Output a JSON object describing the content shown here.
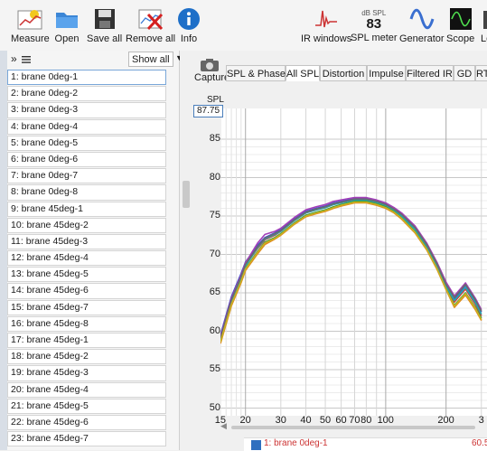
{
  "toolbar": {
    "measure": "Measure",
    "open": "Open",
    "save_all": "Save all",
    "remove_all": "Remove all",
    "info": "Info",
    "ir_windows": "IR windows",
    "spl_meter_unit": "dB SPL",
    "spl_meter_value": "83",
    "spl_meter": "SPL meter",
    "generator": "Generator",
    "scope": "Scope",
    "level_partial": "Le"
  },
  "list": {
    "nav_glyph": "»",
    "filter_value": "Show all",
    "items": [
      "1: brane 0deg-1",
      "2: brane 0deg-2",
      "3: brane 0deg-3",
      "4: brane 0deg-4",
      "5: brane 0deg-5",
      "6: brane 0deg-6",
      "7: brane 0deg-7",
      "8: brane 0deg-8",
      "9: brane 45deg-1",
      "10: brane 45deg-2",
      "11: brane 45deg-3",
      "12: brane 45deg-4",
      "13: brane 45deg-5",
      "14: brane 45deg-6",
      "15: brane 45deg-7",
      "16: brane 45deg-8",
      "17: brane 45deg-1",
      "18: brane 45deg-2",
      "19: brane 45deg-3",
      "20: brane 45deg-4",
      "21: brane 45deg-5",
      "22: brane 45deg-6",
      "23: brane 45deg-7"
    ]
  },
  "graph": {
    "capture": "Capture",
    "tabs": [
      "SPL & Phase",
      "All SPL",
      "Distortion",
      "Impulse",
      "Filtered IR",
      "GD",
      "RT"
    ],
    "active_tab": "All SPL",
    "y_unit": "SPL",
    "y_cursor": "87.75",
    "legend_first": "1: brane 0deg-1",
    "legend_value": "60.5"
  },
  "chart_data": {
    "type": "line",
    "title": "",
    "xlabel": "",
    "ylabel": "SPL",
    "x_scale": "log",
    "xlim": [
      15,
      320
    ],
    "ylim": [
      49,
      89
    ],
    "grid": true,
    "x_ticks": [
      "15",
      "20",
      "30",
      "40",
      "50",
      "60",
      "70",
      "80",
      "100",
      "200",
      "3"
    ],
    "y_ticks": [
      "85",
      "80",
      "75",
      "70",
      "65",
      "60",
      "55",
      "50"
    ],
    "x": [
      15,
      17,
      19,
      20,
      23,
      25,
      28,
      30,
      35,
      40,
      45,
      50,
      55,
      60,
      70,
      80,
      90,
      100,
      110,
      120,
      140,
      160,
      180,
      200,
      220,
      250,
      280,
      300
    ],
    "series": [
      {
        "color": "#3a4fd0",
        "values": [
          59.5,
          64.5,
          67.5,
          69.0,
          71.2,
          72.2,
          72.8,
          73.2,
          74.6,
          75.6,
          76.0,
          76.3,
          76.7,
          76.9,
          77.3,
          77.3,
          77.0,
          76.6,
          76.0,
          75.3,
          73.6,
          71.4,
          68.9,
          66.2,
          64.2,
          66.0,
          64.0,
          62.5
        ]
      },
      {
        "color": "#d23a3a",
        "values": [
          59.0,
          64.0,
          67.0,
          68.6,
          70.8,
          71.9,
          72.5,
          73.0,
          74.4,
          75.4,
          75.8,
          76.1,
          76.5,
          76.8,
          77.1,
          77.1,
          76.8,
          76.4,
          75.8,
          75.1,
          73.3,
          71.1,
          68.6,
          65.9,
          63.8,
          65.5,
          63.5,
          62.0
        ]
      },
      {
        "color": "#2e9a3a",
        "values": [
          58.7,
          63.6,
          66.6,
          68.2,
          70.4,
          71.6,
          72.2,
          72.7,
          74.1,
          75.1,
          75.5,
          75.8,
          76.2,
          76.5,
          76.9,
          76.9,
          76.6,
          76.2,
          75.6,
          74.8,
          73.0,
          70.8,
          68.3,
          65.6,
          63.4,
          65.0,
          63.1,
          61.7
        ]
      },
      {
        "color": "#a23fb8",
        "values": [
          59.3,
          64.3,
          67.3,
          68.9,
          71.5,
          72.6,
          73.0,
          73.4,
          74.8,
          75.8,
          76.2,
          76.5,
          76.9,
          77.1,
          77.4,
          77.4,
          77.1,
          76.7,
          76.1,
          75.4,
          73.7,
          71.5,
          69.0,
          66.4,
          64.6,
          66.3,
          64.3,
          62.8
        ]
      },
      {
        "color": "#e08a1e",
        "values": [
          58.4,
          63.3,
          66.3,
          67.9,
          70.1,
          71.3,
          72.0,
          72.5,
          73.9,
          74.9,
          75.3,
          75.6,
          76.0,
          76.3,
          76.7,
          76.7,
          76.4,
          76.0,
          75.4,
          74.6,
          72.8,
          70.6,
          68.1,
          65.4,
          63.1,
          64.7,
          62.8,
          61.4
        ]
      },
      {
        "color": "#1fa6b3",
        "values": [
          58.9,
          63.9,
          66.9,
          68.5,
          70.9,
          72.0,
          72.6,
          73.0,
          74.4,
          75.4,
          75.8,
          76.1,
          76.5,
          76.7,
          77.1,
          77.1,
          76.8,
          76.4,
          75.8,
          75.0,
          73.3,
          71.1,
          68.6,
          65.9,
          64.0,
          65.7,
          63.7,
          62.2
        ]
      },
      {
        "color": "#6b6b6b",
        "values": [
          59.1,
          64.1,
          67.1,
          68.7,
          71.0,
          72.1,
          72.7,
          73.1,
          74.5,
          75.5,
          75.9,
          76.2,
          76.6,
          76.8,
          77.2,
          77.2,
          76.9,
          76.5,
          75.9,
          75.2,
          73.5,
          71.3,
          68.8,
          66.1,
          64.4,
          66.1,
          64.1,
          62.6
        ]
      },
      {
        "color": "#c9b020",
        "values": [
          58.6,
          63.5,
          66.5,
          68.1,
          70.3,
          71.5,
          72.1,
          72.6,
          74.0,
          75.0,
          75.4,
          75.7,
          76.1,
          76.4,
          76.8,
          76.8,
          76.5,
          76.1,
          75.5,
          74.7,
          72.9,
          70.7,
          68.2,
          65.5,
          63.3,
          64.9,
          63.0,
          61.5
        ]
      }
    ]
  }
}
